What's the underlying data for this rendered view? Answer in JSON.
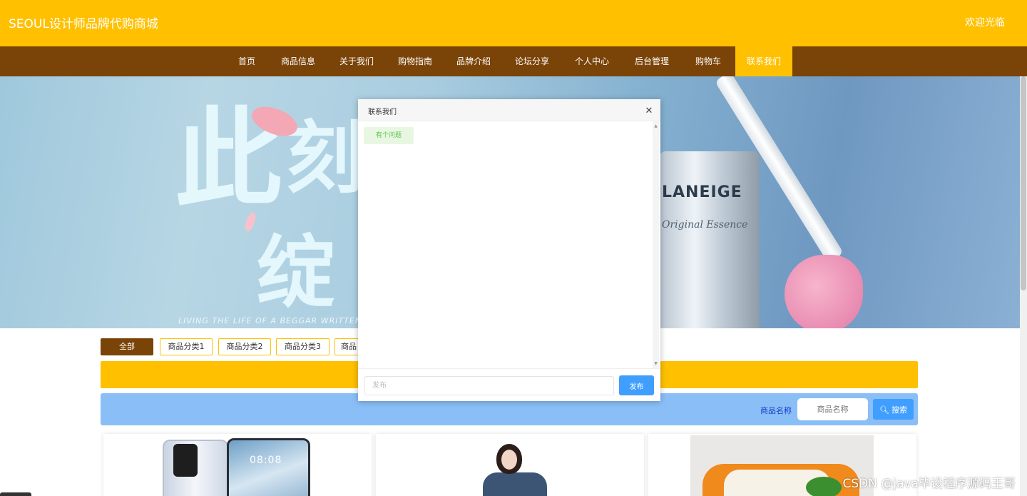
{
  "header": {
    "site_title": "SEOUL设计师品牌代购商城",
    "welcome": "欢迎光临"
  },
  "nav": {
    "items": [
      "首页",
      "商品信息",
      "关于我们",
      "购物指南",
      "品牌介绍",
      "论坛分享",
      "个人中心",
      "后台管理",
      "购物车",
      "联系我们"
    ],
    "active_index": 9
  },
  "banner": {
    "glyph_1": "此",
    "glyph_2": "刻",
    "glyph_3": "绽",
    "tagline": "LIVING THE LIFE OF A BEGGAR WRITTEN B",
    "brand": "LANEIGE",
    "brand_sub": "Original Essence"
  },
  "categories": {
    "items": [
      "全部",
      "商品分类1",
      "商品分类2",
      "商品分类3",
      "商品"
    ],
    "active_index": 0
  },
  "search": {
    "label": "商品名称",
    "placeholder": "商品名称",
    "button": "搜索"
  },
  "products": {
    "phone_time": "08:08"
  },
  "chat": {
    "title": "联系我们",
    "messages": [
      "有个问题"
    ],
    "input_placeholder": "发布",
    "send_label": "发布"
  },
  "watermark": "CSDN @java毕设程序源码王哥",
  "colors": {
    "primary_yellow": "#ffc000",
    "nav_brown": "#7a4307",
    "search_blue": "#8abef7",
    "button_blue": "#409eff",
    "message_green": "#61c14a"
  }
}
